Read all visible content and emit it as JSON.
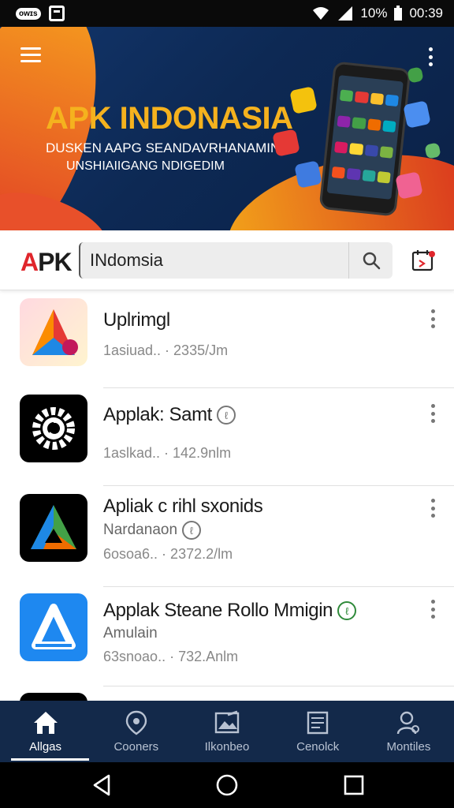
{
  "status_bar": {
    "badge": "ᴏᴡɪs",
    "battery": "10%",
    "time": "00:39"
  },
  "banner": {
    "title": "APK INDONASIA",
    "subtitle_line1": "DUSKEN AAPG SEANDAVRHANAMIN",
    "subtitle_line2": "UNSHIAIIGANG NDIGEDIM"
  },
  "header": {
    "logo_a": "A",
    "logo_pk": "PK",
    "search_value": "INdomsia"
  },
  "apps": [
    {
      "name": "Uplrimgl",
      "sub": "",
      "meta": "1asiuad.. · 2335/Jm",
      "verified": ""
    },
    {
      "name": "Applak: Samt",
      "sub": "",
      "meta": "1aslkad.. · 142.9nlm",
      "verified": "ℓ"
    },
    {
      "name": "Apliak c rihl sxonids",
      "sub": "Nardanaon",
      "meta": "6osoa6.. · 2372.2/lm",
      "verified": "ℓ"
    },
    {
      "name": "Applak Steane Rollo Mmigin",
      "sub": "Amulain",
      "meta": "63snoao.. · 732.Anlm",
      "verified": "ℓ"
    }
  ],
  "bottom_nav": [
    {
      "label": "Allgas",
      "icon": "home-icon",
      "active": true
    },
    {
      "label": "Cooners",
      "icon": "location-pin-icon",
      "active": false
    },
    {
      "label": "Ilkonbeo",
      "icon": "gallery-icon",
      "active": false
    },
    {
      "label": "Cenolck",
      "icon": "document-icon",
      "active": false
    },
    {
      "label": "Montiles",
      "icon": "profile-icon",
      "active": false
    }
  ],
  "colors": {
    "accent_orange": "#f5b21e",
    "nav_bg": "#13294a",
    "logo_red": "#e0262c"
  }
}
